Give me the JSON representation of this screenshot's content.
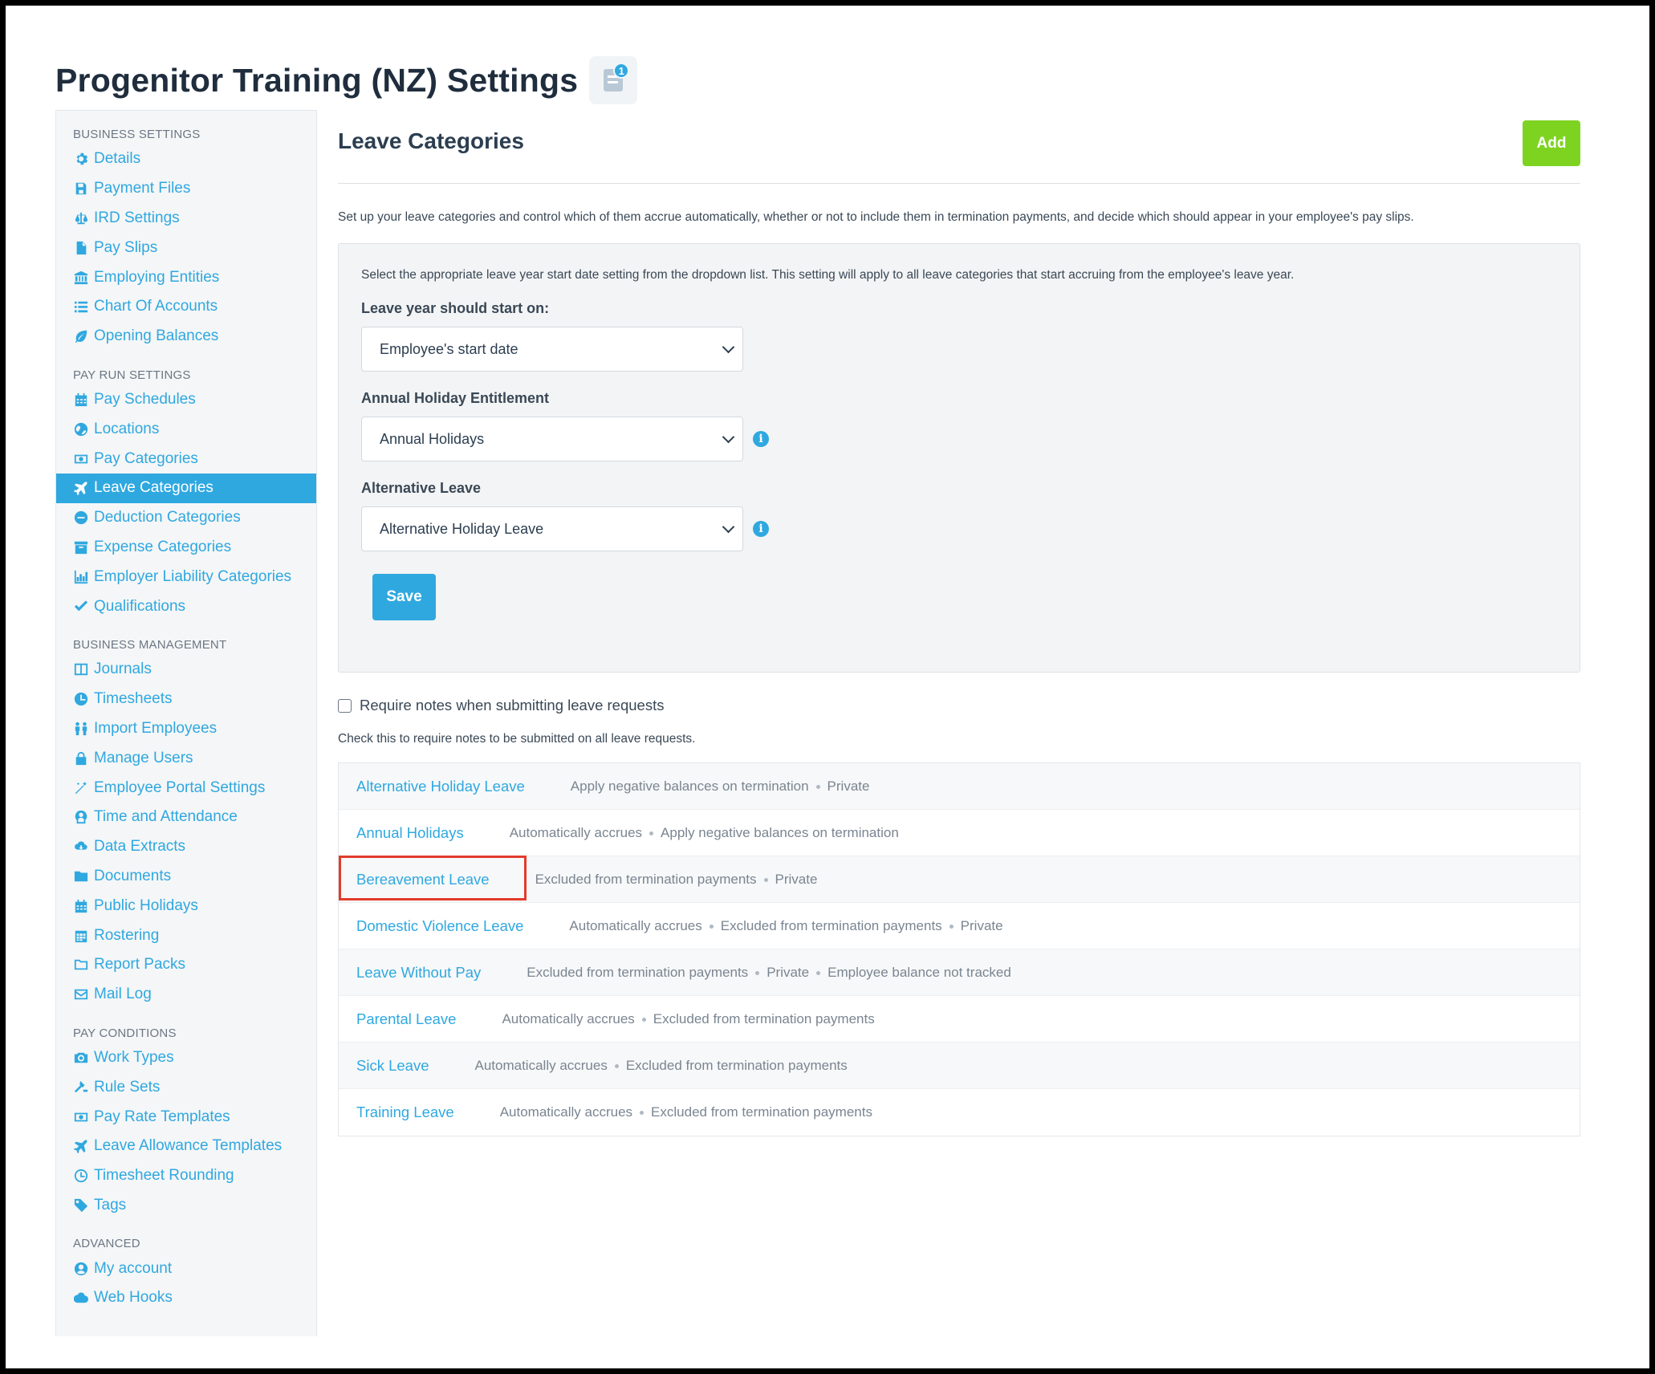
{
  "page": {
    "title": "Progenitor Training (NZ) Settings",
    "notification_count": "1"
  },
  "sidebar": {
    "sections": [
      {
        "title": "BUSINESS SETTINGS",
        "items": [
          {
            "label": "Details",
            "icon": "gear-icon"
          },
          {
            "label": "Payment Files",
            "icon": "save-icon"
          },
          {
            "label": "IRD Settings",
            "icon": "scale-icon"
          },
          {
            "label": "Pay Slips",
            "icon": "file-icon"
          },
          {
            "label": "Employing Entities",
            "icon": "bank-icon"
          },
          {
            "label": "Chart Of Accounts",
            "icon": "list-icon"
          },
          {
            "label": "Opening Balances",
            "icon": "leaf-icon"
          }
        ]
      },
      {
        "title": "PAY RUN SETTINGS",
        "items": [
          {
            "label": "Pay Schedules",
            "icon": "calendar-icon"
          },
          {
            "label": "Locations",
            "icon": "globe-icon"
          },
          {
            "label": "Pay Categories",
            "icon": "money-icon"
          },
          {
            "label": "Leave Categories",
            "icon": "plane-icon",
            "active": true
          },
          {
            "label": "Deduction Categories",
            "icon": "minus-circle-icon"
          },
          {
            "label": "Expense Categories",
            "icon": "archive-icon"
          },
          {
            "label": "Employer Liability Categories",
            "icon": "bar-chart-icon"
          },
          {
            "label": "Qualifications",
            "icon": "check-icon"
          }
        ]
      },
      {
        "title": "BUSINESS MANAGEMENT",
        "items": [
          {
            "label": "Journals",
            "icon": "columns-icon"
          },
          {
            "label": "Timesheets",
            "icon": "pie-clock-icon"
          },
          {
            "label": "Import Employees",
            "icon": "users-icon"
          },
          {
            "label": "Manage Users",
            "icon": "lock-icon"
          },
          {
            "label": "Employee Portal Settings",
            "icon": "magic-wand-icon"
          },
          {
            "label": "Time and Attendance",
            "icon": "clock-person-icon"
          },
          {
            "label": "Data Extracts",
            "icon": "cloud-download-icon"
          },
          {
            "label": "Documents",
            "icon": "folder-icon"
          },
          {
            "label": "Public Holidays",
            "icon": "calendar-icon"
          },
          {
            "label": "Rostering",
            "icon": "calendar-grid-icon"
          },
          {
            "label": "Report Packs",
            "icon": "folder-open-icon"
          },
          {
            "label": "Mail Log",
            "icon": "envelope-icon"
          }
        ]
      },
      {
        "title": "PAY CONDITIONS",
        "items": [
          {
            "label": "Work Types",
            "icon": "camera-icon"
          },
          {
            "label": "Rule Sets",
            "icon": "gavel-icon"
          },
          {
            "label": "Pay Rate Templates",
            "icon": "money-icon"
          },
          {
            "label": "Leave Allowance Templates",
            "icon": "plane-icon"
          },
          {
            "label": "Timesheet Rounding",
            "icon": "clock-icon"
          },
          {
            "label": "Tags",
            "icon": "tag-icon"
          }
        ]
      },
      {
        "title": "ADVANCED",
        "items": [
          {
            "label": "My account",
            "icon": "user-circle-icon"
          },
          {
            "label": "Web Hooks",
            "icon": "cloud-icon"
          }
        ]
      }
    ]
  },
  "main": {
    "title": "Leave Categories",
    "add_label": "Add",
    "intro": "Set up your leave categories and control which of them accrue automatically, whether or not to include them in termination payments, and decide which should appear in your employee's pay slips.",
    "panel_note": "Select the appropriate leave year start date setting from the dropdown list. This setting will apply to all leave categories that start accruing from the employee's leave year.",
    "leave_year_label": "Leave year should start on:",
    "leave_year_value": "Employee's start date",
    "annual_label": "Annual Holiday Entitlement",
    "annual_value": "Annual Holidays",
    "alt_label": "Alternative Leave",
    "alt_value": "Alternative Holiday Leave",
    "save_label": "Save",
    "require_notes_label": "Require notes when submitting leave requests",
    "require_notes_help": "Check this to require notes to be submitted on all leave requests.",
    "categories": [
      {
        "name": "Alternative Holiday Leave",
        "tags": [
          "Apply negative balances on termination",
          "Private"
        ]
      },
      {
        "name": "Annual Holidays",
        "tags": [
          "Automatically accrues",
          "Apply negative balances on termination"
        ]
      },
      {
        "name": "Bereavement Leave",
        "tags": [
          "Excluded from termination payments",
          "Private"
        ],
        "highlighted": true
      },
      {
        "name": "Domestic Violence Leave",
        "tags": [
          "Automatically accrues",
          "Excluded from termination payments",
          "Private"
        ]
      },
      {
        "name": "Leave Without Pay",
        "tags": [
          "Excluded from termination payments",
          "Private",
          "Employee balance not tracked"
        ]
      },
      {
        "name": "Parental Leave",
        "tags": [
          "Automatically accrues",
          "Excluded from termination payments"
        ]
      },
      {
        "name": "Sick Leave",
        "tags": [
          "Automatically accrues",
          "Excluded from termination payments"
        ]
      },
      {
        "name": "Training Leave",
        "tags": [
          "Automatically accrues",
          "Excluded from termination payments"
        ]
      }
    ]
  },
  "colors": {
    "accent": "#2fa8e0",
    "add_button": "#7ed321",
    "highlight_box": "#e23b2a"
  }
}
